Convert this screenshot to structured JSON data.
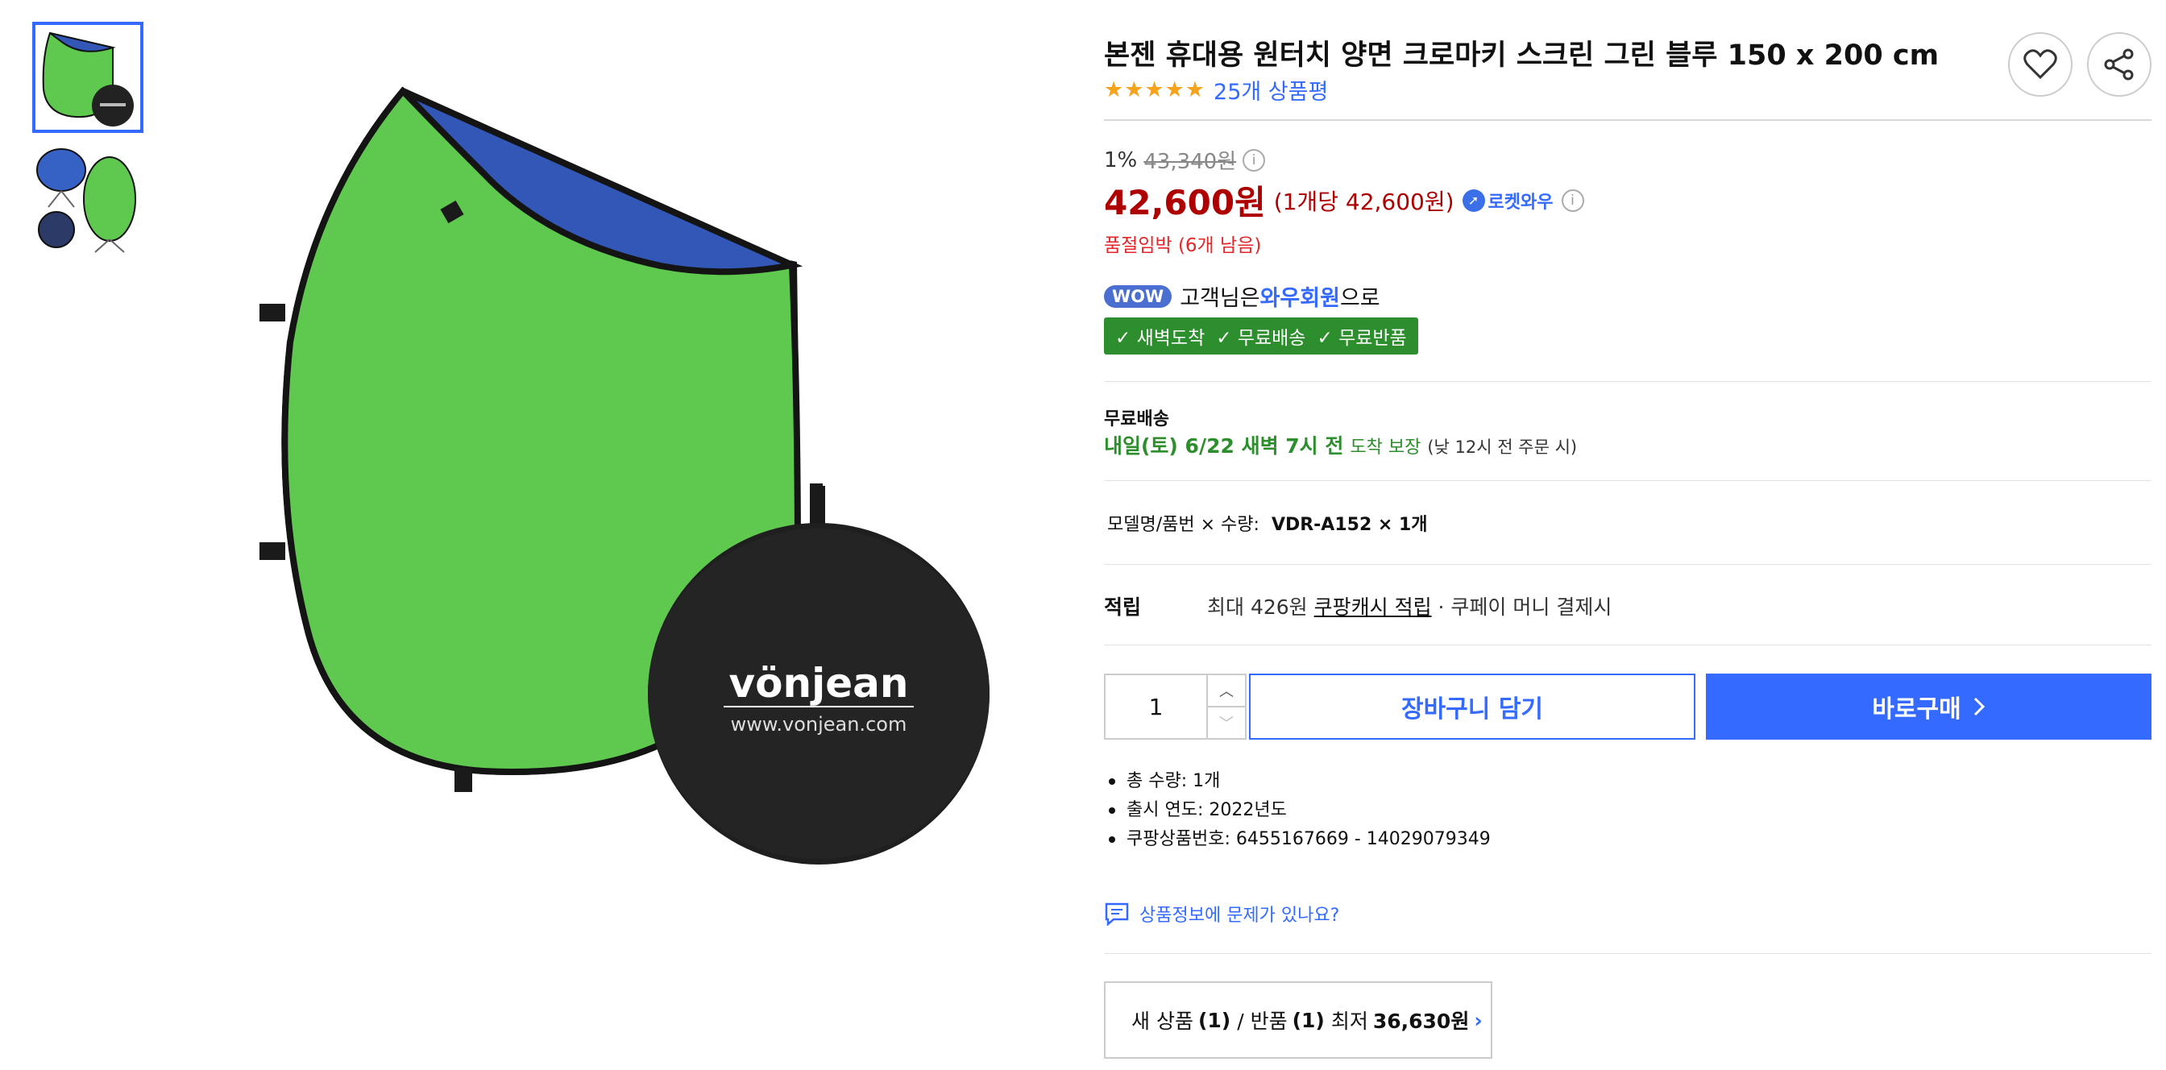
{
  "product": {
    "title": "본젠 휴대용 원터치 양면 크로마키 스크린 그린 블루 150 x 200 cm",
    "stars": "★★★★★",
    "review_link": "25개 상품평",
    "brand_logo_text": "vönjean",
    "brand_url_text": "www.vonjean.com"
  },
  "icons": [
    "heart-icon",
    "share-icon",
    "info-icon",
    "rocket-icon",
    "check-icon",
    "chevron-up-icon",
    "chevron-down-icon",
    "chevron-right-icon",
    "report-icon"
  ],
  "price": {
    "discount_rate": "1%",
    "original_price": "43,340원",
    "sale_price": "42,600원",
    "unit_price": "(1개당 42,600원)",
    "rocket_label": "로켓와우"
  },
  "stock_notice": "품절임박 (6개 남음)",
  "wow": {
    "badge": "WOW",
    "text_before": "고객님은",
    "member": "와우회원",
    "text_after": "으로",
    "benefits": [
      "새벽도착",
      "무료배송",
      "무료반품"
    ]
  },
  "shipping": {
    "title": "무료배송",
    "date": "내일(토) 6/22 새벽 7시 전",
    "guarantee": "도착 보장",
    "note": "(낮 12시 전 주문 시)"
  },
  "option": {
    "label": "모델명/품번 × 수량:",
    "value": "VDR-A152 × 1개"
  },
  "reward": {
    "label": "적립",
    "prefix": "최대 426원",
    "link": "쿠팡캐시 적립",
    "suffix": "· 쿠페이 머니 결제시"
  },
  "purchase": {
    "quantity": "1",
    "cart_label": "장바구니 담기",
    "buy_label": "바로구매"
  },
  "details": [
    "총 수량: 1개",
    "출시 연도: 2022년도",
    "쿠팡상품번호: 6455167669 - 14029079349"
  ],
  "report_link": "상품정보에 문제가 있나요?",
  "offer": {
    "prefix": "새 상품",
    "new_count": "(1)",
    "middle": "/ 반품",
    "return_count": "(1)",
    "lowest_label": "최저",
    "lowest_price": "36,630원"
  },
  "colors": {
    "accent": "#346aff",
    "price": "#ae0000",
    "green": "#2d8e2d",
    "screen_green": "#5fc94f",
    "screen_blue": "#3357b7"
  }
}
